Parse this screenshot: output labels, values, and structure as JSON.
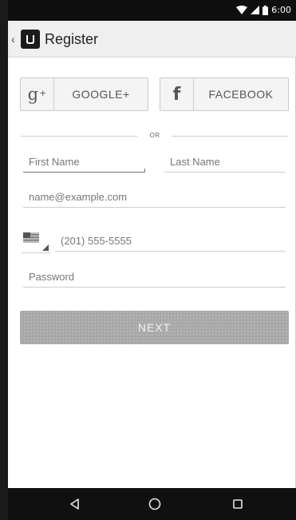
{
  "status_bar": {
    "time": "6:00",
    "icons": [
      "wifi-icon",
      "signal-icon",
      "battery-icon"
    ]
  },
  "app_bar": {
    "title": "Register",
    "logo_icon": "uber-logo-icon",
    "back_icon": "chevron-left-icon"
  },
  "social": {
    "google_label": "GOOGLE+",
    "google_icon": "google-plus-icon",
    "facebook_label": "FACEBOOK",
    "facebook_icon": "facebook-icon"
  },
  "divider": {
    "text": "OR"
  },
  "form": {
    "first_name_placeholder": "First Name",
    "last_name_placeholder": "Last Name",
    "email_placeholder": "name@example.com",
    "country_flag_icon": "us-flag-icon",
    "phone_placeholder": "(201) 555-5555",
    "password_placeholder": "Password"
  },
  "next_button": {
    "label": "NEXT",
    "state": "disabled"
  },
  "nav_bar": {
    "icons": [
      "back-triangle-icon",
      "home-circle-icon",
      "recents-square-icon"
    ]
  },
  "colors": {
    "status_bar": "#0f0f0f",
    "app_bar": "#efefef",
    "button_bg": "#f4f4f4",
    "next_disabled": "#a8a8a8",
    "nav_bar": "#101010"
  }
}
